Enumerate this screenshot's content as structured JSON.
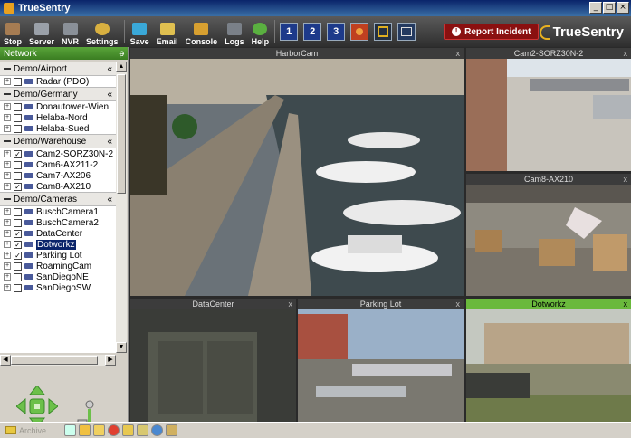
{
  "window": {
    "title": "TrueSentry",
    "minimize": "_",
    "maximize": "□",
    "close": "×"
  },
  "toolbar": {
    "buttons": [
      {
        "label": "Stop",
        "icon": "stop-icon"
      },
      {
        "label": "Server",
        "icon": "server-icon"
      },
      {
        "label": "NVR",
        "icon": "nvr-icon"
      },
      {
        "label": "Settings",
        "icon": "settings-icon"
      },
      {
        "label": "Save",
        "icon": "save-icon"
      },
      {
        "label": "Email",
        "icon": "email-icon"
      },
      {
        "label": "Console",
        "icon": "console-icon"
      },
      {
        "label": "Logs",
        "icon": "logs-icon"
      },
      {
        "label": "Help",
        "icon": "help-icon"
      }
    ],
    "layouts": [
      "1",
      "2",
      "3"
    ],
    "report_label": "Report Incident",
    "brand": "TrueSentry"
  },
  "network": {
    "title": "Network",
    "pin": "ᵽ",
    "collapse_glyph": "«",
    "groups": [
      {
        "name": "Demo/Airport",
        "items": [
          {
            "label": "Radar (PDO)",
            "checked": false
          }
        ]
      },
      {
        "name": "Demo/Germany",
        "items": [
          {
            "label": "Donautower-Wien",
            "checked": false
          },
          {
            "label": "Helaba-Nord",
            "checked": false
          },
          {
            "label": "Helaba-Sued",
            "checked": false
          }
        ]
      },
      {
        "name": "Demo/Warehouse",
        "items": [
          {
            "label": "Cam2-SORZ30N-2",
            "checked": true
          },
          {
            "label": "Cam6-AX211-2",
            "checked": false
          },
          {
            "label": "Cam7-AX206",
            "checked": false
          },
          {
            "label": "Cam8-AX210",
            "checked": true
          }
        ]
      },
      {
        "name": "Demo/Cameras",
        "items": [
          {
            "label": "BuschCamera1",
            "checked": false
          },
          {
            "label": "BuschCamera2",
            "checked": false
          },
          {
            "label": "DataCenter",
            "checked": true
          },
          {
            "label": "Dotworkz",
            "checked": true,
            "selected": true
          },
          {
            "label": "Parking Lot",
            "checked": true
          },
          {
            "label": "RoamingCam",
            "checked": false
          },
          {
            "label": "SanDiegoNE",
            "checked": false
          },
          {
            "label": "SanDiegoSW",
            "checked": false
          }
        ]
      }
    ]
  },
  "tiles": {
    "harbor": "HarborCam",
    "cam2": "Cam2-SORZ30N-2",
    "cam8": "Cam8-AX210",
    "datacenter": "DataCenter",
    "parking": "Parking Lot",
    "dotworkz": "Dotworkz",
    "close": "x"
  },
  "status": {
    "archive_label": "Archive"
  },
  "colors": {
    "accent_green": "#6ab93c",
    "report_red": "#8a1010",
    "selected_bg": "#0a246a"
  }
}
